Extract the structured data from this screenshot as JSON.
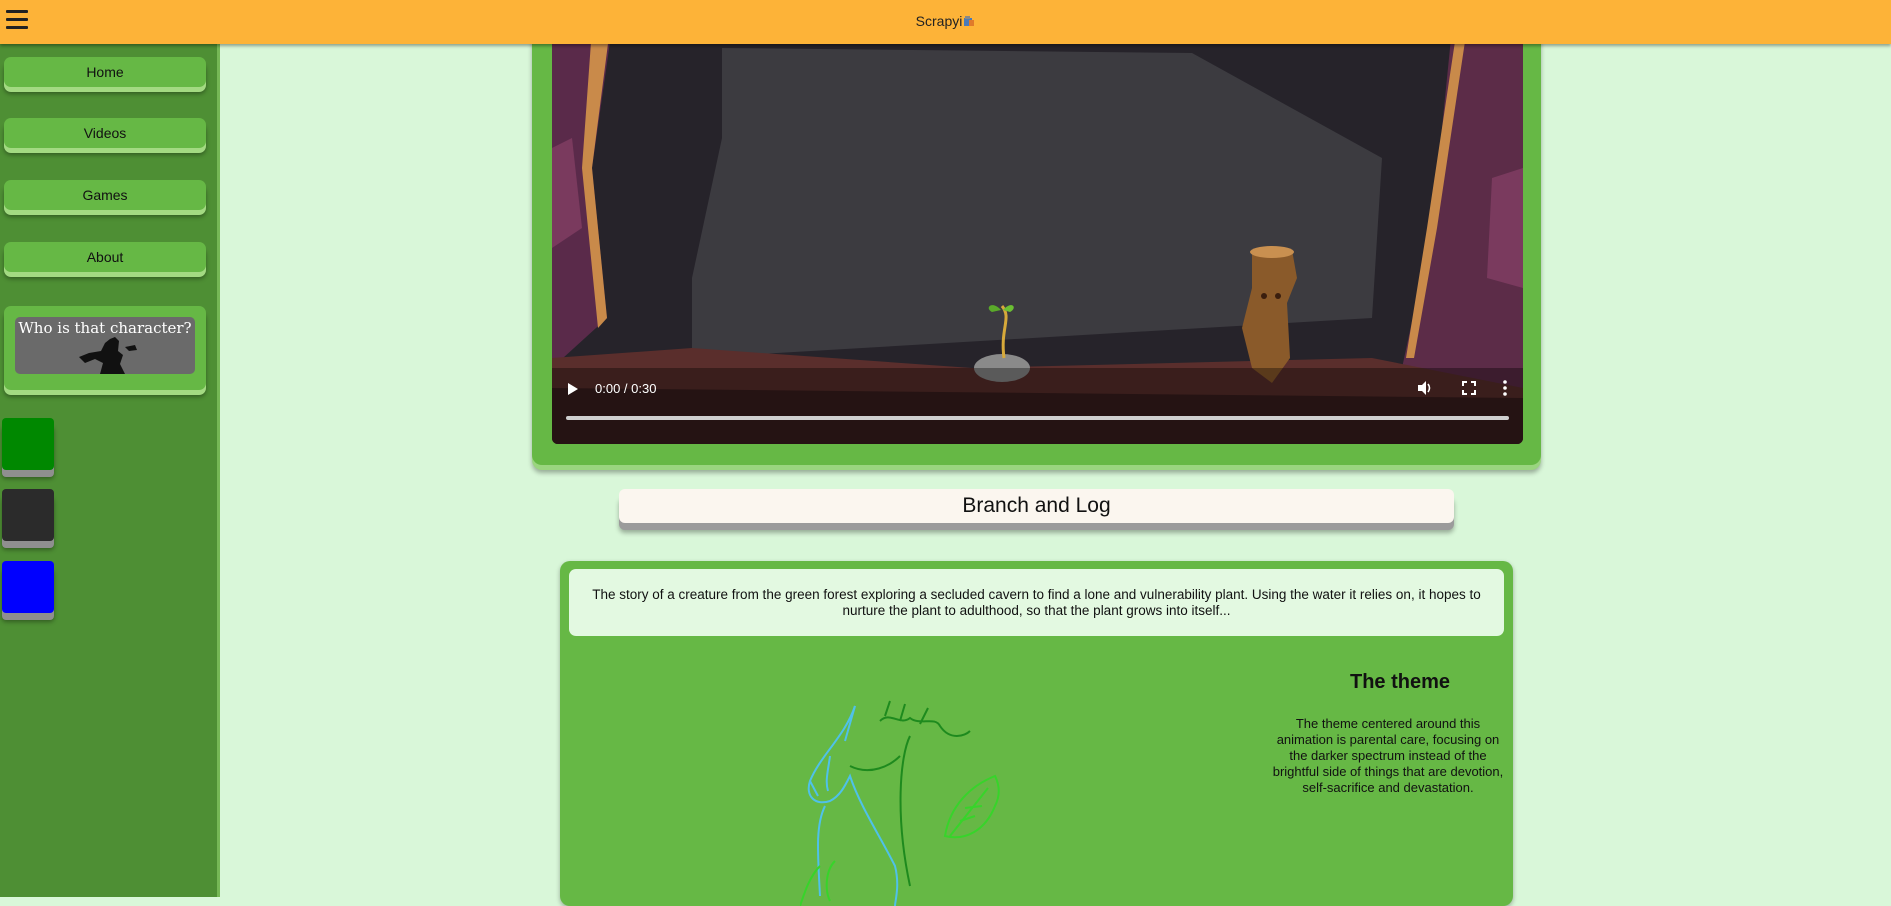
{
  "header": {
    "brand": "Scrapyi",
    "brand_icon": "paint-bucket-icon",
    "menu_icon": "hamburger-menu-icon"
  },
  "sidebar": {
    "items": [
      {
        "label": "Home"
      },
      {
        "label": "Videos"
      },
      {
        "label": "Games"
      },
      {
        "label": "About"
      }
    ],
    "character_card": {
      "title": "Who is that character?"
    },
    "theme_swatches": [
      "#008800",
      "#2b2b2b",
      "#0000ff"
    ]
  },
  "video": {
    "time": "0:00 / 0:30",
    "progress": 0
  },
  "page": {
    "title": "Branch and Log",
    "description": "The story of a creature from the green forest exploring a secluded cavern to find a lone and vulnerability plant. Using the water it relies on, it hopes to nurture the plant to adulthood, so that the plant grows into itself...",
    "theme_title": "The theme",
    "theme_text": "The theme centered around this animation is parental care, focusing on the darker spectrum instead of the brightful side of things that are devotion, self-sacrifice and devastation."
  },
  "colors": {
    "header": "#fdb338",
    "sidebar": "#4e8f34",
    "button": "#66b845",
    "background": "#d9f7d9"
  }
}
